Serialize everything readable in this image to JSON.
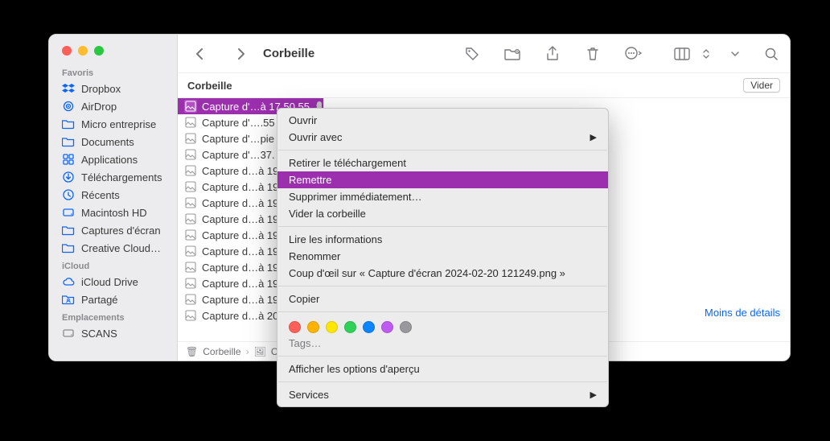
{
  "window": {
    "title": "Corbeille"
  },
  "traffic": {
    "close": "",
    "min": "",
    "max": ""
  },
  "toolbar": {
    "back": "",
    "forward": "",
    "icons": [
      "tag",
      "folder-action",
      "share",
      "trash",
      "more",
      "view",
      "view-dropdown",
      "search"
    ]
  },
  "subheader": {
    "label": "Corbeille",
    "empty_btn": "Vider"
  },
  "sidebar": {
    "sections": [
      {
        "title": "Favoris",
        "items": [
          {
            "icon": "dropbox",
            "label": "Dropbox"
          },
          {
            "icon": "airdrop",
            "label": "AirDrop"
          },
          {
            "icon": "folder",
            "label": "Micro entreprise"
          },
          {
            "icon": "folder",
            "label": "Documents"
          },
          {
            "icon": "apps",
            "label": "Applications"
          },
          {
            "icon": "download",
            "label": "Téléchargements"
          },
          {
            "icon": "recent",
            "label": "Récents"
          },
          {
            "icon": "disk",
            "label": "Macintosh HD"
          },
          {
            "icon": "folder",
            "label": "Captures d'écran"
          },
          {
            "icon": "folder",
            "label": "Creative Cloud…"
          }
        ]
      },
      {
        "title": "iCloud",
        "items": [
          {
            "icon": "cloud",
            "label": "iCloud Drive"
          },
          {
            "icon": "shared",
            "label": "Partagé"
          }
        ]
      },
      {
        "title": "Emplacements",
        "items": [
          {
            "icon": "disk-gray",
            "label": "SCANS"
          }
        ]
      }
    ]
  },
  "file_list": {
    "items": [
      {
        "name": "Capture d'…à 17.50.55",
        "selected": true
      },
      {
        "name": "Capture d'….55",
        "selected": false
      },
      {
        "name": "Capture d'…pie",
        "selected": false
      },
      {
        "name": "Capture d'…37.",
        "selected": false
      },
      {
        "name": "Capture d…à 19",
        "selected": false
      },
      {
        "name": "Capture d…à 19",
        "selected": false
      },
      {
        "name": "Capture d…à 19",
        "selected": false
      },
      {
        "name": "Capture d…à 19",
        "selected": false
      },
      {
        "name": "Capture d…à 19",
        "selected": false
      },
      {
        "name": "Capture d…à 19",
        "selected": false
      },
      {
        "name": "Capture d…à 19",
        "selected": false
      },
      {
        "name": "Capture d…à 19",
        "selected": false
      },
      {
        "name": "Capture d…à 19",
        "selected": false
      },
      {
        "name": "Capture d…à 20",
        "selected": false
      }
    ]
  },
  "preview": {
    "details_link": "Moins de détails"
  },
  "pathbar": {
    "items": [
      {
        "icon": "trash",
        "label": "Corbeille"
      },
      {
        "icon": "image",
        "label": "Ca"
      }
    ]
  },
  "context_menu": {
    "groups": [
      [
        {
          "label": "Ouvrir",
          "sub": false
        },
        {
          "label": "Ouvrir avec",
          "sub": true
        }
      ],
      [
        {
          "label": "Retirer le téléchargement",
          "sub": false
        },
        {
          "label": "Remettre",
          "sub": false,
          "highlight": true
        },
        {
          "label": "Supprimer immédiatement…",
          "sub": false
        },
        {
          "label": "Vider la corbeille",
          "sub": false
        }
      ],
      [
        {
          "label": "Lire les informations",
          "sub": false
        },
        {
          "label": "Renommer",
          "sub": false
        },
        {
          "label": "Coup d'œil sur « Capture d'écran 2024-02-20 121249.png »",
          "sub": false
        }
      ],
      [
        {
          "label": "Copier",
          "sub": false
        }
      ]
    ],
    "tag_colors": [
      "#ff5f57",
      "#ffb300",
      "#ffe600",
      "#30d158",
      "#0a84ff",
      "#bf5af2",
      "#98989d"
    ],
    "tags_label": "Tags…",
    "after_tags": [
      [
        {
          "label": "Afficher les options d'aperçu",
          "sub": false
        }
      ],
      [
        {
          "label": "Services",
          "sub": true
        }
      ]
    ]
  }
}
